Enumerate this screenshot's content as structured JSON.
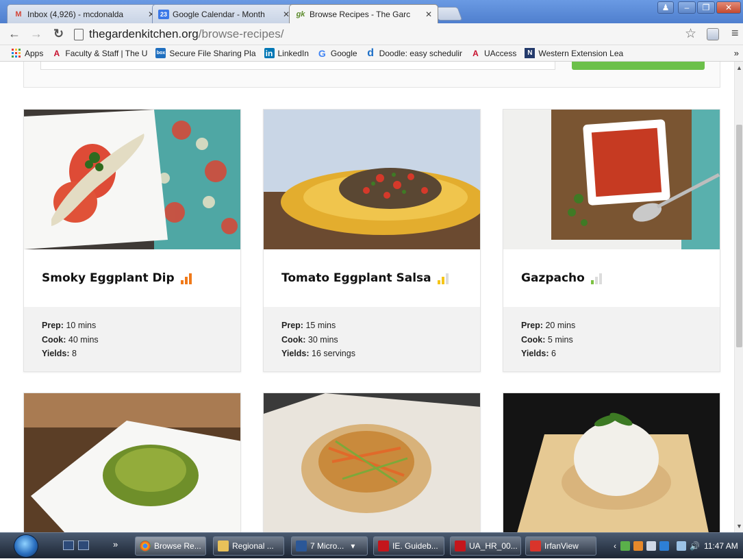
{
  "tabs": [
    {
      "label": "Inbox (4,926) - mcdonalda",
      "favicon": "gmail-icon",
      "glyph": "M",
      "color": "#d44638"
    },
    {
      "label": "Google Calendar - Month",
      "favicon": "calendar-icon",
      "glyph": "23",
      "color": "#3b78e7"
    },
    {
      "label": "Browse Recipes - The Garc",
      "favicon": "garden-kitchen-icon",
      "glyph": "gk",
      "color": "#5a8a2a"
    }
  ],
  "address": {
    "domain": "thegardenkitchen.org",
    "path": "/browse-recipes/"
  },
  "bookmarks": [
    {
      "label": "Apps",
      "icon": "apps-grid-icon"
    },
    {
      "label": "Faculty & Staff | The U",
      "icon": "university-icon"
    },
    {
      "label": "Secure File Sharing Pla",
      "icon": "box-icon"
    },
    {
      "label": "LinkedIn",
      "icon": "linkedin-icon"
    },
    {
      "label": "Google",
      "icon": "google-icon"
    },
    {
      "label": "Doodle: easy schedulir",
      "icon": "doodle-icon"
    },
    {
      "label": "UAccess",
      "icon": "university-icon"
    },
    {
      "label": "Western Extension Lea",
      "icon": "extension-icon"
    }
  ],
  "bookmarks_more": "»",
  "recipes": [
    {
      "title": "Smoky Eggplant Dip",
      "difficulty": 3,
      "diff_color": "#f07a1a",
      "prep_label": "Prep:",
      "prep": "10 mins",
      "cook_label": "Cook:",
      "cook": "40 mins",
      "yields_label": "Yields:",
      "yields": "8"
    },
    {
      "title": "Tomato Eggplant Salsa",
      "difficulty": 2,
      "diff_color": "#f5c518",
      "prep_label": "Prep:",
      "prep": "15 mins",
      "cook_label": "Cook:",
      "cook": "30 mins",
      "yields_label": "Yields:",
      "yields": "16 servings"
    },
    {
      "title": "Gazpacho",
      "difficulty": 1,
      "diff_color": "#7cc242",
      "prep_label": "Prep:",
      "prep": "20 mins",
      "cook_label": "Cook:",
      "cook": "5 mins",
      "yields_label": "Yields:",
      "yields": "6"
    },
    {
      "title": "",
      "image": "zucchini-noodles"
    },
    {
      "title": "",
      "image": "fish-parchment"
    },
    {
      "title": "",
      "image": "rice-mold"
    }
  ],
  "taskbar": [
    {
      "label": "Browse Re...",
      "icon": "chrome-icon"
    },
    {
      "label": "Regional ...",
      "icon": "folder-icon"
    },
    {
      "label": "7 Micro...",
      "icon": "word-icon"
    },
    {
      "label": "IE. Guideb...",
      "icon": "pdf-icon"
    },
    {
      "label": "UA_HR_00...",
      "icon": "pdf-icon"
    },
    {
      "label": "IrfanView",
      "icon": "irfanview-icon"
    }
  ],
  "quick_more": "»",
  "clock": "11:47 AM"
}
